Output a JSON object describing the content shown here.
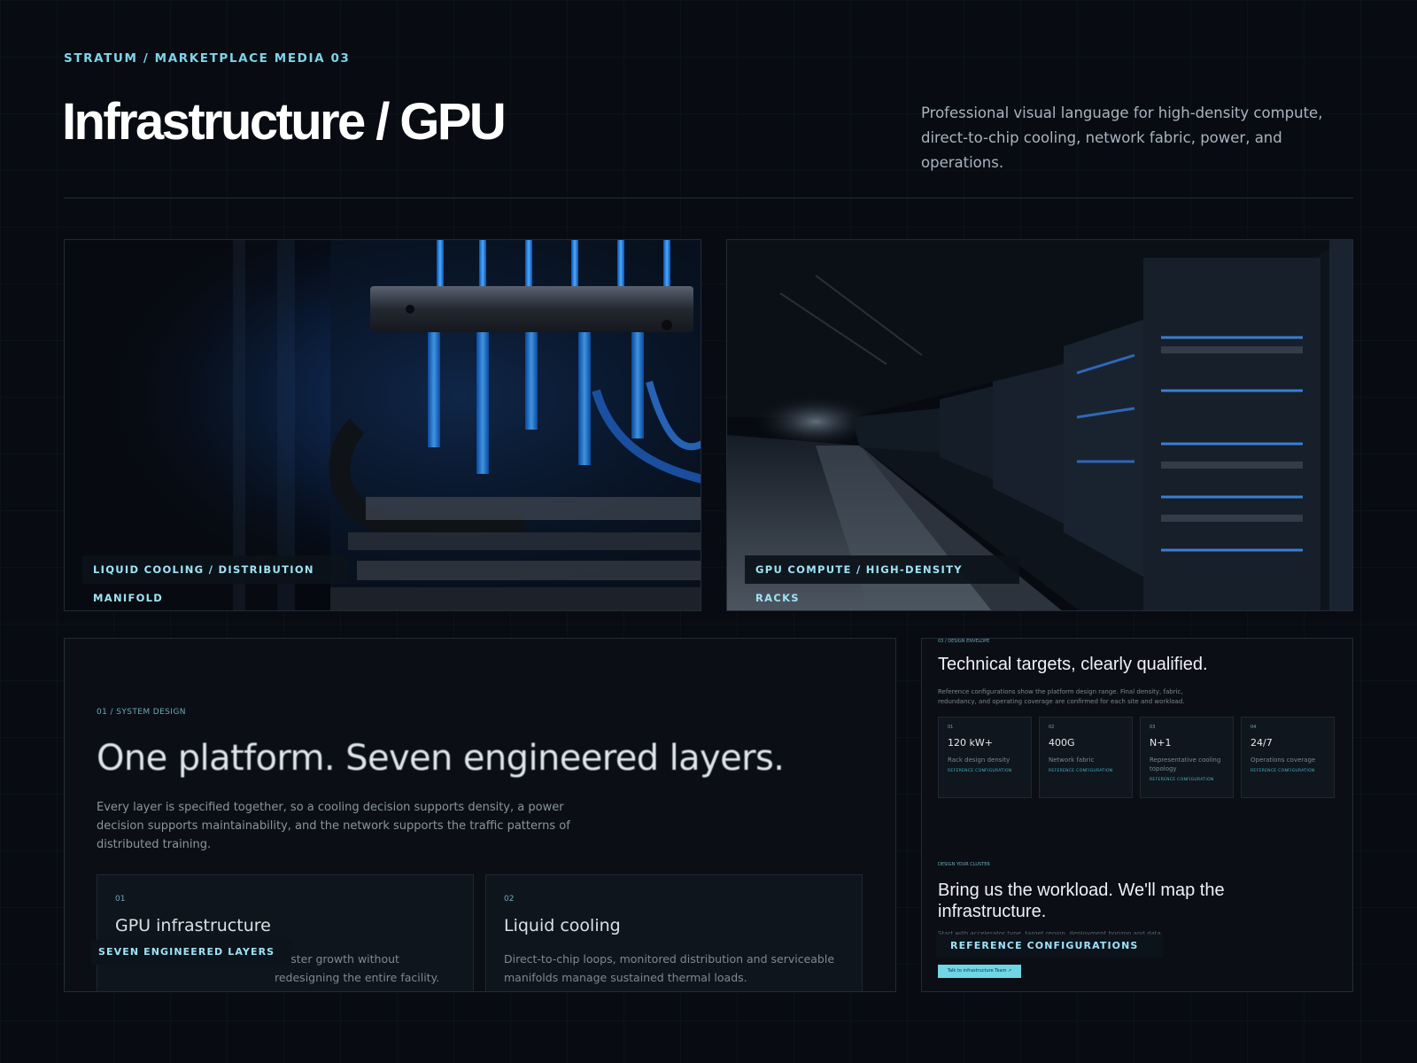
{
  "header": {
    "eyebrow": "STRATUM / MARKETPLACE MEDIA 03",
    "title": "Infrastructure / GPU",
    "intro": "Professional visual language for high-density compute, direct-to-chip cooling, network fabric, power, and operations."
  },
  "media": [
    {
      "caption": "LIQUID COOLING / DISTRIBUTION MANIFOLD"
    },
    {
      "caption": "GPU COMPUTE / HIGH-DENSITY RACKS"
    }
  ],
  "system": {
    "eyebrow": "01 / SYSTEM DESIGN",
    "title": "One platform. Seven engineered layers.",
    "description": "Every layer is specified together, so a cooling decision supports density, a power decision supports maintainability, and the network supports the traffic patterns of distributed training.",
    "cards": [
      {
        "num": "01",
        "title": "GPU infrastructure",
        "desc": "cluster growth without redesigning the entire facility."
      },
      {
        "num": "02",
        "title": "Liquid cooling",
        "desc": "Direct-to-chip loops, monitored distribution and serviceable manifolds manage sustained thermal loads."
      }
    ],
    "tag": "SEVEN ENGINEERED LAYERS"
  },
  "technical": {
    "eyebrow": "03 / DESIGN ENVELOPE",
    "title": "Technical targets, clearly qualified.",
    "description": "Reference configurations show the platform design range. Final density, fabric, redundancy, and operating coverage are confirmed for each site and workload.",
    "stats": [
      {
        "num": "01",
        "value": "120 kW+",
        "label": "Rack design density",
        "ref": "REFERENCE CONFIGURATION"
      },
      {
        "num": "02",
        "value": "400G",
        "label": "Network fabric",
        "ref": "REFERENCE CONFIGURATION"
      },
      {
        "num": "03",
        "value": "N+1",
        "label": "Representative cooling topology",
        "ref": "REFERENCE CONFIGURATION"
      },
      {
        "num": "04",
        "value": "24/7",
        "label": "Operations coverage",
        "ref": "REFERENCE CONFIGURATION"
      }
    ],
    "cta_eyebrow": "DESIGN YOUR CLUSTER",
    "cta_title": "Bring us the workload. We'll map the infrastructure.",
    "cta_faint": "Start with accelerator type, target region, deployment horizon and data movement",
    "tag": "REFERENCE CONFIGURATIONS",
    "button": "Talk to infrastructure Team ↗"
  }
}
